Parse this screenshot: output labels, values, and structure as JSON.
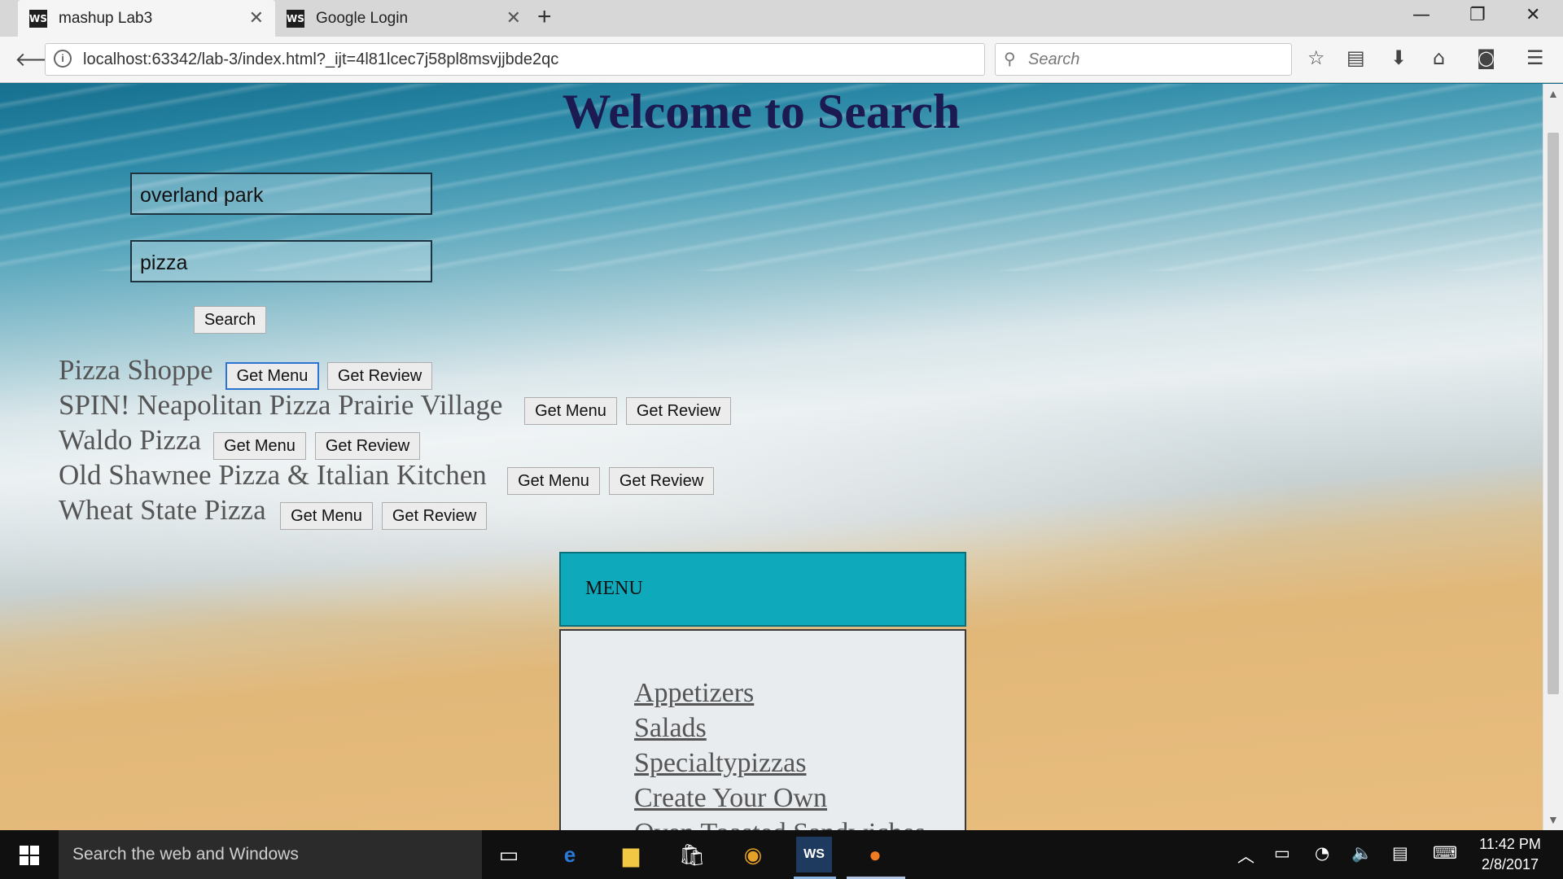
{
  "browser": {
    "tabs": [
      {
        "label": "mashup Lab3",
        "favicon": "WS"
      },
      {
        "label": "Google Login",
        "favicon": "WS"
      }
    ],
    "new_tab_symbol": "+",
    "window_controls": {
      "minimize": "—",
      "restore": "❐",
      "close": "✕"
    },
    "url": "localhost:63342/lab-3/index.html?_ijt=4l81lcec7j58pl8msvjjbde2qc",
    "search_placeholder": "Search",
    "icons": [
      "back-arrow-icon",
      "info-icon",
      "reload-icon",
      "search-icon",
      "bookmark-star-icon",
      "reading-list-icon",
      "download-icon",
      "home-icon",
      "pocket-icon",
      "menu-hamburger-icon"
    ]
  },
  "page": {
    "title": "Welcome to Search",
    "location_value": "overland park",
    "term_value": "pizza",
    "search_label": "Search",
    "results": [
      {
        "name": "Pizza Shoppe",
        "menu_label": "Get Menu",
        "review_label": "Get Review"
      },
      {
        "name": "SPIN! Neapolitan Pizza Prairie Village",
        "menu_label": "Get Menu",
        "review_label": "Get Review"
      },
      {
        "name": "Waldo Pizza",
        "menu_label": "Get Menu",
        "review_label": "Get Review"
      },
      {
        "name": "Old Shawnee Pizza & Italian Kitchen",
        "menu_label": "Get Menu",
        "review_label": "Get Review"
      },
      {
        "name": "Wheat State Pizza",
        "menu_label": "Get Menu",
        "review_label": "Get Review"
      }
    ],
    "menu": {
      "header": "MENU",
      "items": [
        "Appetizers",
        "Salads",
        "Specialtypizzas",
        "Create Your Own",
        "Oven Toasted Sandwiches"
      ]
    },
    "colors": {
      "title": "#1b1b52",
      "menu_header_bg": "#0fa9bc"
    }
  },
  "taskbar": {
    "search_placeholder": "Search the web and Windows",
    "time": "11:42 PM",
    "date": "2/8/2017",
    "apps": [
      "task-view-icon",
      "edge-icon",
      "file-explorer-icon",
      "store-icon",
      "chrome-icon",
      "webstorm-icon",
      "firefox-icon"
    ]
  }
}
